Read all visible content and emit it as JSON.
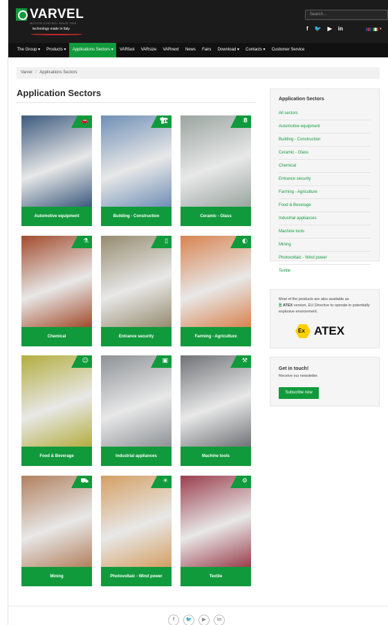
{
  "header": {
    "brand": "VARVEL",
    "brand_sub": "MOTION CONTROL SINCE 1955",
    "tagline": "technology made in Italy",
    "search_placeholder": "Search...",
    "social": [
      "f",
      "🐦",
      "▶",
      "in"
    ],
    "lang": "▾"
  },
  "nav": {
    "items": [
      {
        "label": "The Group ▾"
      },
      {
        "label": "Products ▾"
      },
      {
        "label": "Applications Sectors ▾",
        "active": true
      },
      {
        "label": "VARfast"
      },
      {
        "label": "VARsize"
      },
      {
        "label": "VARnext"
      },
      {
        "label": "News"
      },
      {
        "label": "Fairs"
      },
      {
        "label": "Download ▾"
      },
      {
        "label": "Contacts ▾"
      },
      {
        "label": "Customer Service"
      }
    ]
  },
  "breadcrumb": {
    "home": "Varvel",
    "current": "Applications Sectors"
  },
  "page": {
    "title": "Application Sectors"
  },
  "tiles": [
    {
      "label": "Automotive equipment",
      "icon": "car-icon",
      "glyph": "🚗",
      "color": "#3c5a7e"
    },
    {
      "label": "Building - Construction",
      "icon": "crane-icon",
      "glyph": "🏗",
      "color": "#6f8fb6"
    },
    {
      "label": "Ceramic - Glass",
      "icon": "glass-icon",
      "glyph": "8",
      "color": "#9aa5a0"
    },
    {
      "label": "Chemical",
      "icon": "chemical-icon",
      "glyph": "⚗",
      "color": "#a24b2c"
    },
    {
      "label": "Entrance security",
      "icon": "door-icon",
      "glyph": "▯",
      "color": "#958b6e"
    },
    {
      "label": "Farming - Agriculture",
      "icon": "egg-icon",
      "glyph": "◐",
      "color": "#d88350"
    },
    {
      "label": "Food & Beverage",
      "icon": "food-icon",
      "glyph": "☺",
      "color": "#b3ad3e"
    },
    {
      "label": "Industrial appliances",
      "icon": "oven-icon",
      "glyph": "▣",
      "color": "#8e9296"
    },
    {
      "label": "Machine tools",
      "icon": "drill-icon",
      "glyph": "⚒",
      "color": "#6f7276"
    },
    {
      "label": "Mining",
      "icon": "truck-icon",
      "glyph": "⛟",
      "color": "#b2805e"
    },
    {
      "label": "Photovoltaic - Wind power",
      "icon": "solar-icon",
      "glyph": "☀",
      "color": "#d49f63"
    },
    {
      "label": "Textile",
      "icon": "textile-icon",
      "glyph": "⚙",
      "color": "#9a3e4c"
    }
  ],
  "sidebar": {
    "title": "Application Sectors",
    "links": [
      "All sectors",
      "Automotive equipment",
      "Building - Construction",
      "Ceramic - Glass",
      "Chemical",
      "Entrance security",
      "Farming - Agriculture",
      "Food & Beverage",
      "Industrial appliances",
      "Machine tools",
      "Mining",
      "Photovoltaic - Wind power",
      "Textile"
    ],
    "atex_lead": "Most of the products are also available as",
    "atex_bold": "ATEX",
    "atex_rest": "version, EU Directive to operate in potentially explosive environment.",
    "atex_logo_word": "ATEX",
    "atex_logo_ex": "Ex",
    "contact_title": "Get in touch!",
    "contact_text": "Receive our newsletter.",
    "subscribe_label": "Subscribe now"
  },
  "footer": {
    "social": [
      "f",
      "🐦",
      "▶",
      "in"
    ]
  }
}
